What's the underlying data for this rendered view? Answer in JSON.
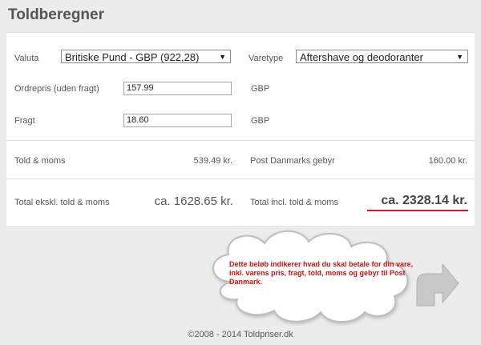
{
  "title": "Toldberegner",
  "form": {
    "valuta_label": "Valuta",
    "valuta_value": "Britiske Pund - GBP (922,28)",
    "varetype_label": "Varetype",
    "varetype_value": "Aftershave og deodoranter",
    "ordrepris_label": "Ordrepris (uden fragt)",
    "ordrepris_value": "157.99",
    "ordrepris_unit": "GBP",
    "fragt_label": "Fragt",
    "fragt_value": "18.60",
    "fragt_unit": "GBP"
  },
  "results": {
    "told_moms_label": "Told & moms",
    "told_moms_value": "539.49 kr.",
    "post_gebyr_label": "Post Danmarks gebyr",
    "post_gebyr_value": "160.00 kr.",
    "total_ekskl_label": "Total ekskl. told & moms",
    "total_ekskl_value": "ca. 1628.65 kr.",
    "total_incl_label": "Total incl. told & moms",
    "total_incl_value": "ca. 2328.14 kr."
  },
  "cloud": {
    "text": "Dette beløb indikerer hvad du skal betale for din vare, inkl. varens pris, fragt, told, moms og gebyr til Post Danmark."
  },
  "footer": {
    "text": "©2008 - 2014 Toldpriser.dk"
  },
  "colors": {
    "accent_red": "#c0202a",
    "cloud_text": "#d01010",
    "background": "#ececec"
  }
}
